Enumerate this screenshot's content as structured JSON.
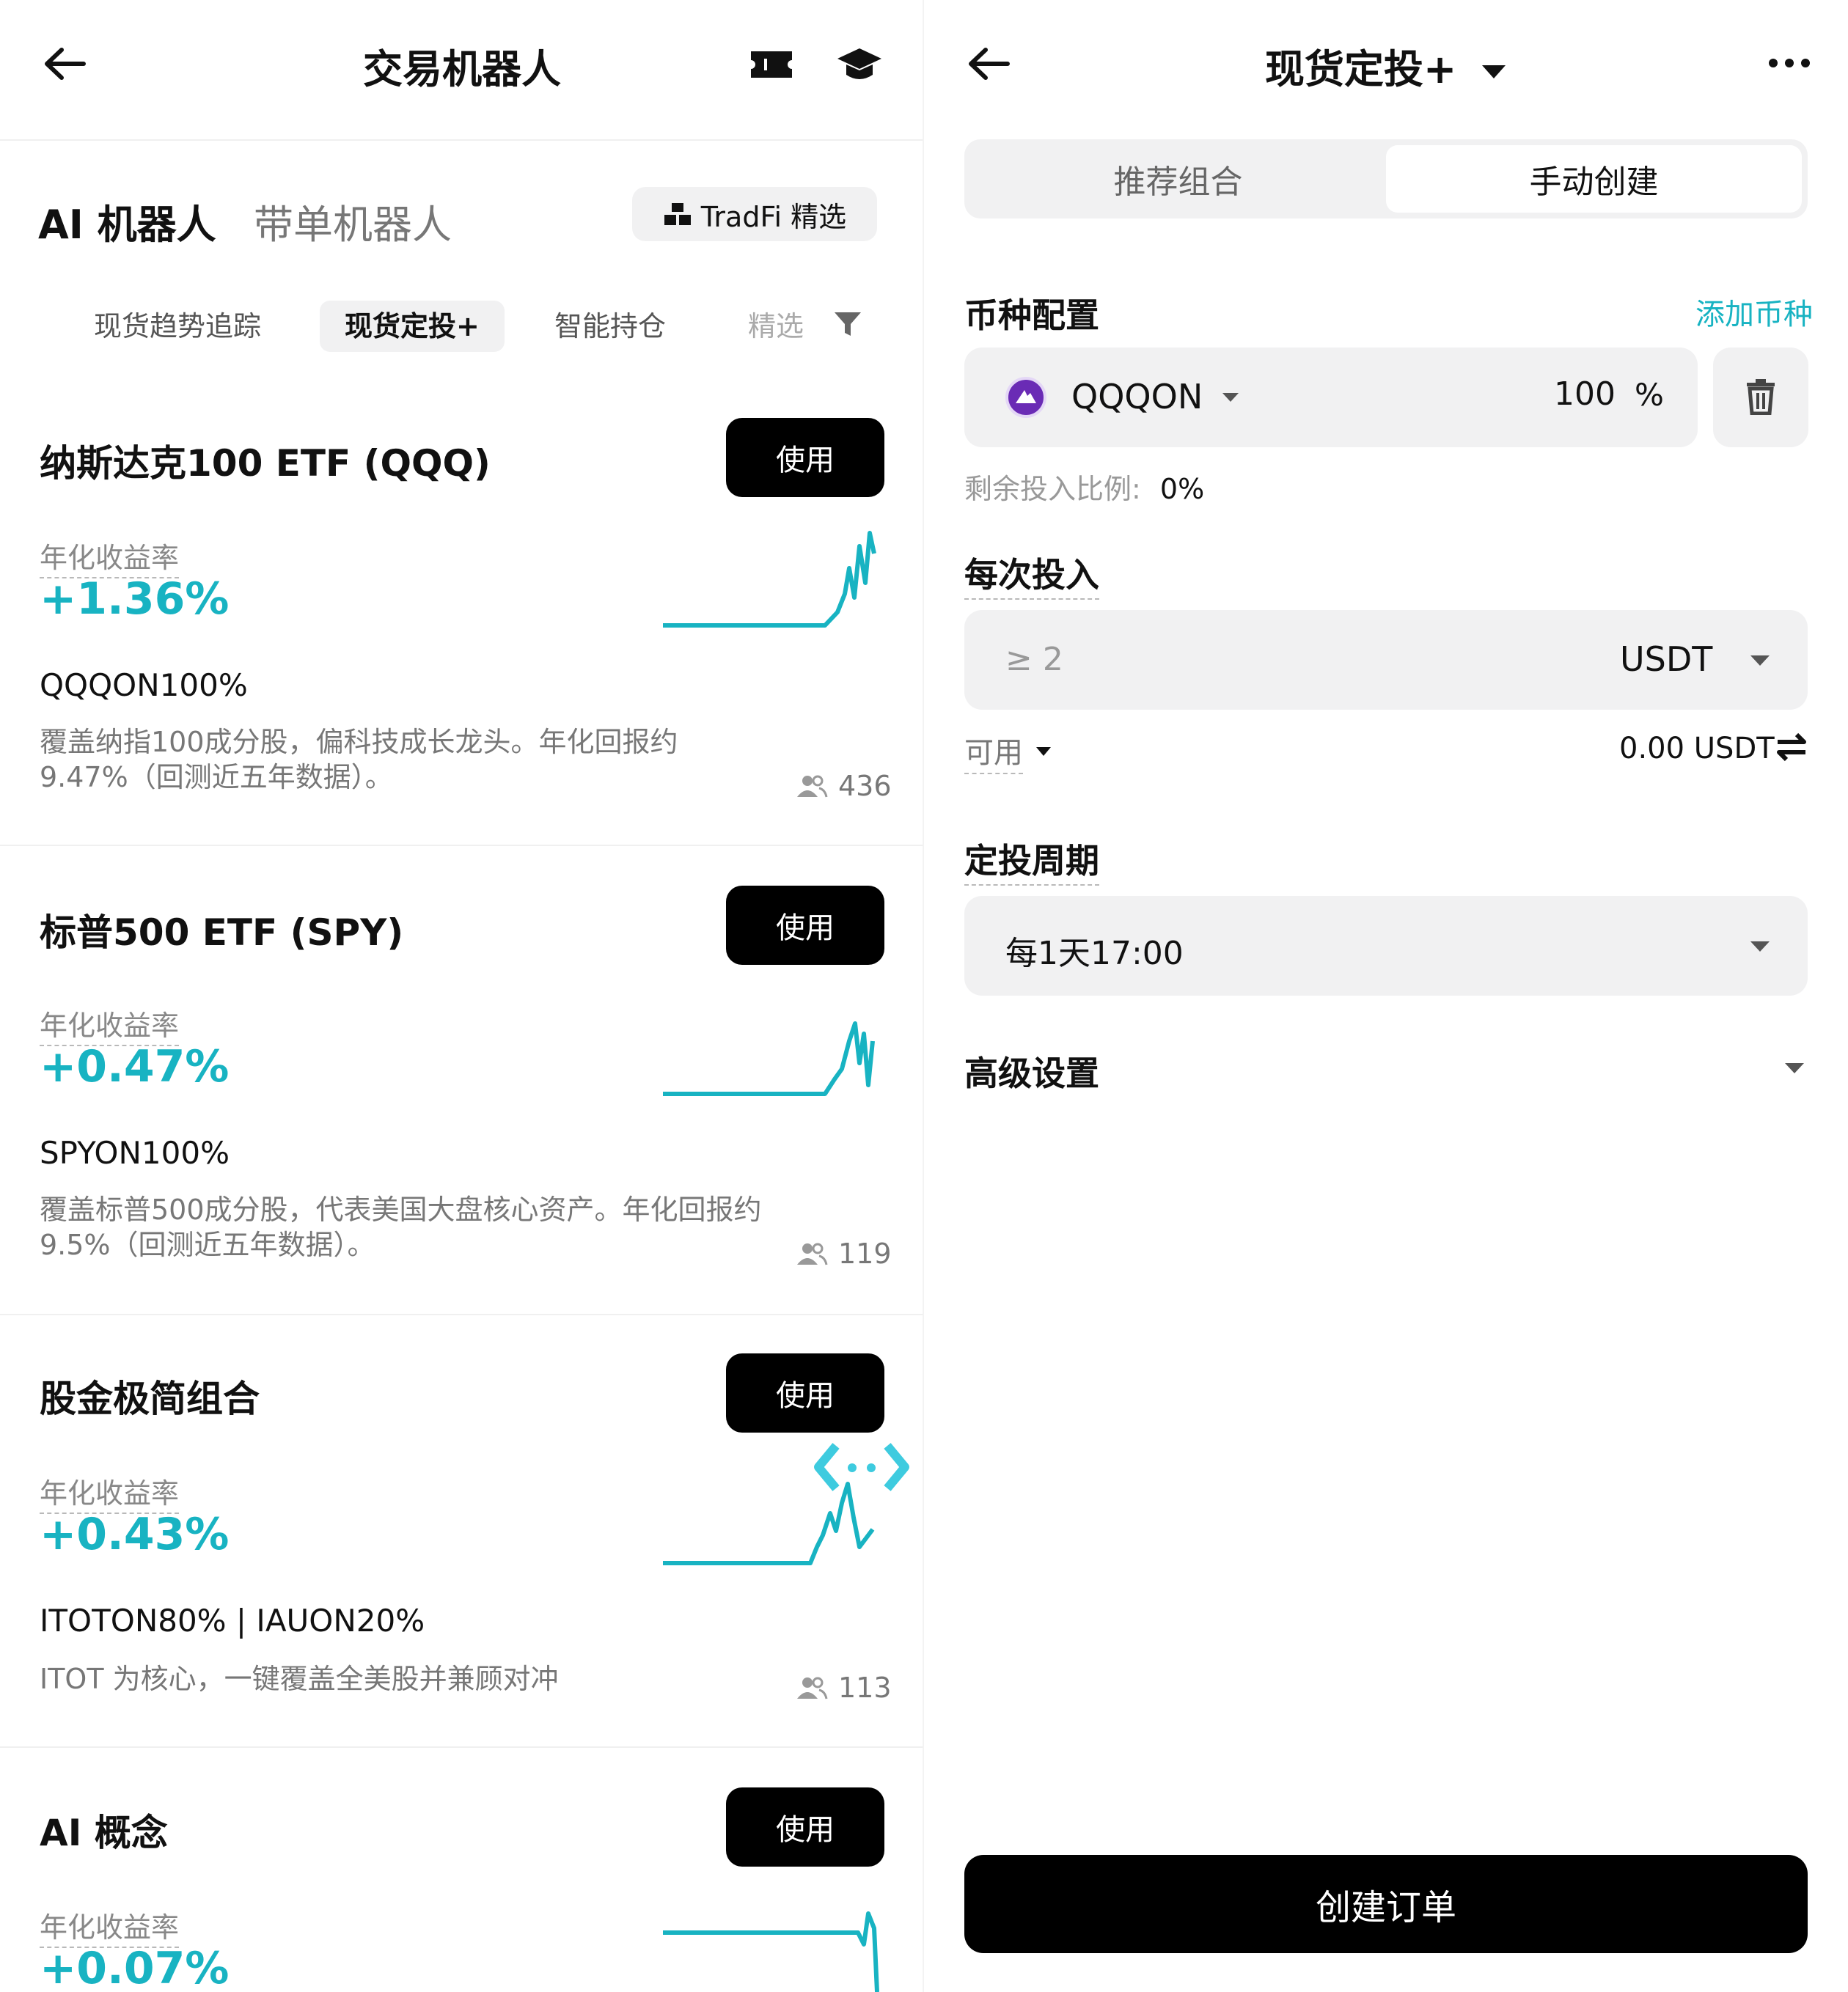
{
  "left": {
    "header_title": "交易机器人",
    "top_tabs": [
      "AI 机器人",
      "带单机器人"
    ],
    "tradfi_label": "TradFi 精选",
    "sub_tabs": [
      "现货趋势追踪",
      "现货定投+",
      "智能持仓",
      "精选"
    ],
    "rate_label": "年化收益率",
    "use_label": "使用",
    "cards": [
      {
        "title": "纳斯达克100 ETF (QQQ)",
        "rate": "+1.36%",
        "alloc": "QQQON100%",
        "desc": "覆盖纳指100成分股，偏科技成长龙头。年化回报约 9.47%（回测近五年数据）。",
        "users": "436"
      },
      {
        "title": "标普500 ETF (SPY)",
        "rate": "+0.47%",
        "alloc": "SPYON100%",
        "desc": "覆盖标普500成分股，代表美国大盘核心资产。年化回报约 9.5%（回测近五年数据）。",
        "users": "119"
      },
      {
        "title": "股金极简组合",
        "rate": "+0.43%",
        "alloc": "ITOTON80% | IAUON20%",
        "desc": "ITOT 为核心，一键覆盖全美股并兼顾对冲",
        "users": "113"
      },
      {
        "title": "AI 概念",
        "rate": "+0.07%"
      }
    ]
  },
  "right": {
    "header_title": "现货定投+",
    "segments": [
      "推荐组合",
      "手动创建"
    ],
    "coin_section_label": "币种配置",
    "add_coin_label": "添加币种",
    "coin": {
      "symbol": "QQQON",
      "percent": "100",
      "percent_unit": "%"
    },
    "remaining_label": "剩余投入比例:",
    "remaining_value": "0%",
    "per_invest_label": "每次投入",
    "per_invest_placeholder": "≥ 2",
    "per_invest_currency": "USDT",
    "available_label": "可用",
    "available_value": "0.00 USDT",
    "cycle_label": "定投周期",
    "cycle_value": "每1天17:00",
    "advanced_label": "高级设置",
    "create_label": "创建订单"
  },
  "colors": {
    "accent": "#18b3c2",
    "button_bg": "#000000",
    "field_bg": "#f1f1f2"
  },
  "icons": [
    "back-arrow-icon",
    "ticket-icon",
    "graduation-cap-icon",
    "users-icon",
    "filter-icon",
    "dropdown-caret-icon",
    "more-icon",
    "trash-icon",
    "swap-icon",
    "coin-logo-icon"
  ]
}
